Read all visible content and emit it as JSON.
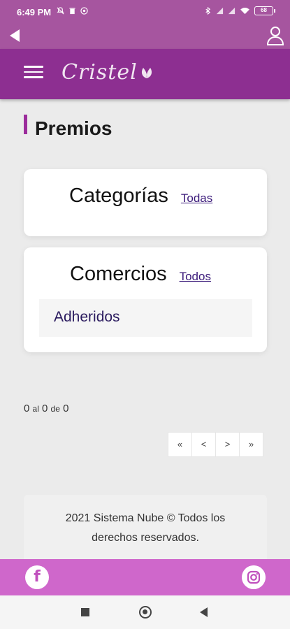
{
  "status_bar": {
    "time": "6:49 PM",
    "battery": "68",
    "icons_left": [
      "silent-icon",
      "trash-icon",
      "sync-icon"
    ],
    "icons_right": [
      "bluetooth-icon",
      "signal-icon",
      "signal-icon",
      "wifi-icon",
      "battery-icon"
    ]
  },
  "top_bar": {
    "back_icon": "back-arrow-icon",
    "user_icon": "user-icon"
  },
  "header": {
    "logo": "Cristel",
    "menu_icon": "hamburger-icon"
  },
  "page": {
    "title": "Premios"
  },
  "categories": {
    "title": "Categorías",
    "link": "Todas"
  },
  "commerces": {
    "title": "Comercios",
    "link": "Todos",
    "items": [
      "Adheridos"
    ]
  },
  "pagination": {
    "from": "0",
    "sep1": "al",
    "to": "0",
    "sep2": "de",
    "total": "0",
    "buttons": [
      "«",
      "<",
      ">",
      "»"
    ]
  },
  "footer": {
    "text": "2021 Sistema Nube © Todos los derechos reservados."
  },
  "social": {
    "facebook": "f",
    "instagram_icon": "instagram-icon"
  },
  "colors": {
    "top_bar": "#a6559f",
    "header": "#8d2f91",
    "social_bar": "#cf67cb",
    "accent": "#9b2c9b"
  }
}
